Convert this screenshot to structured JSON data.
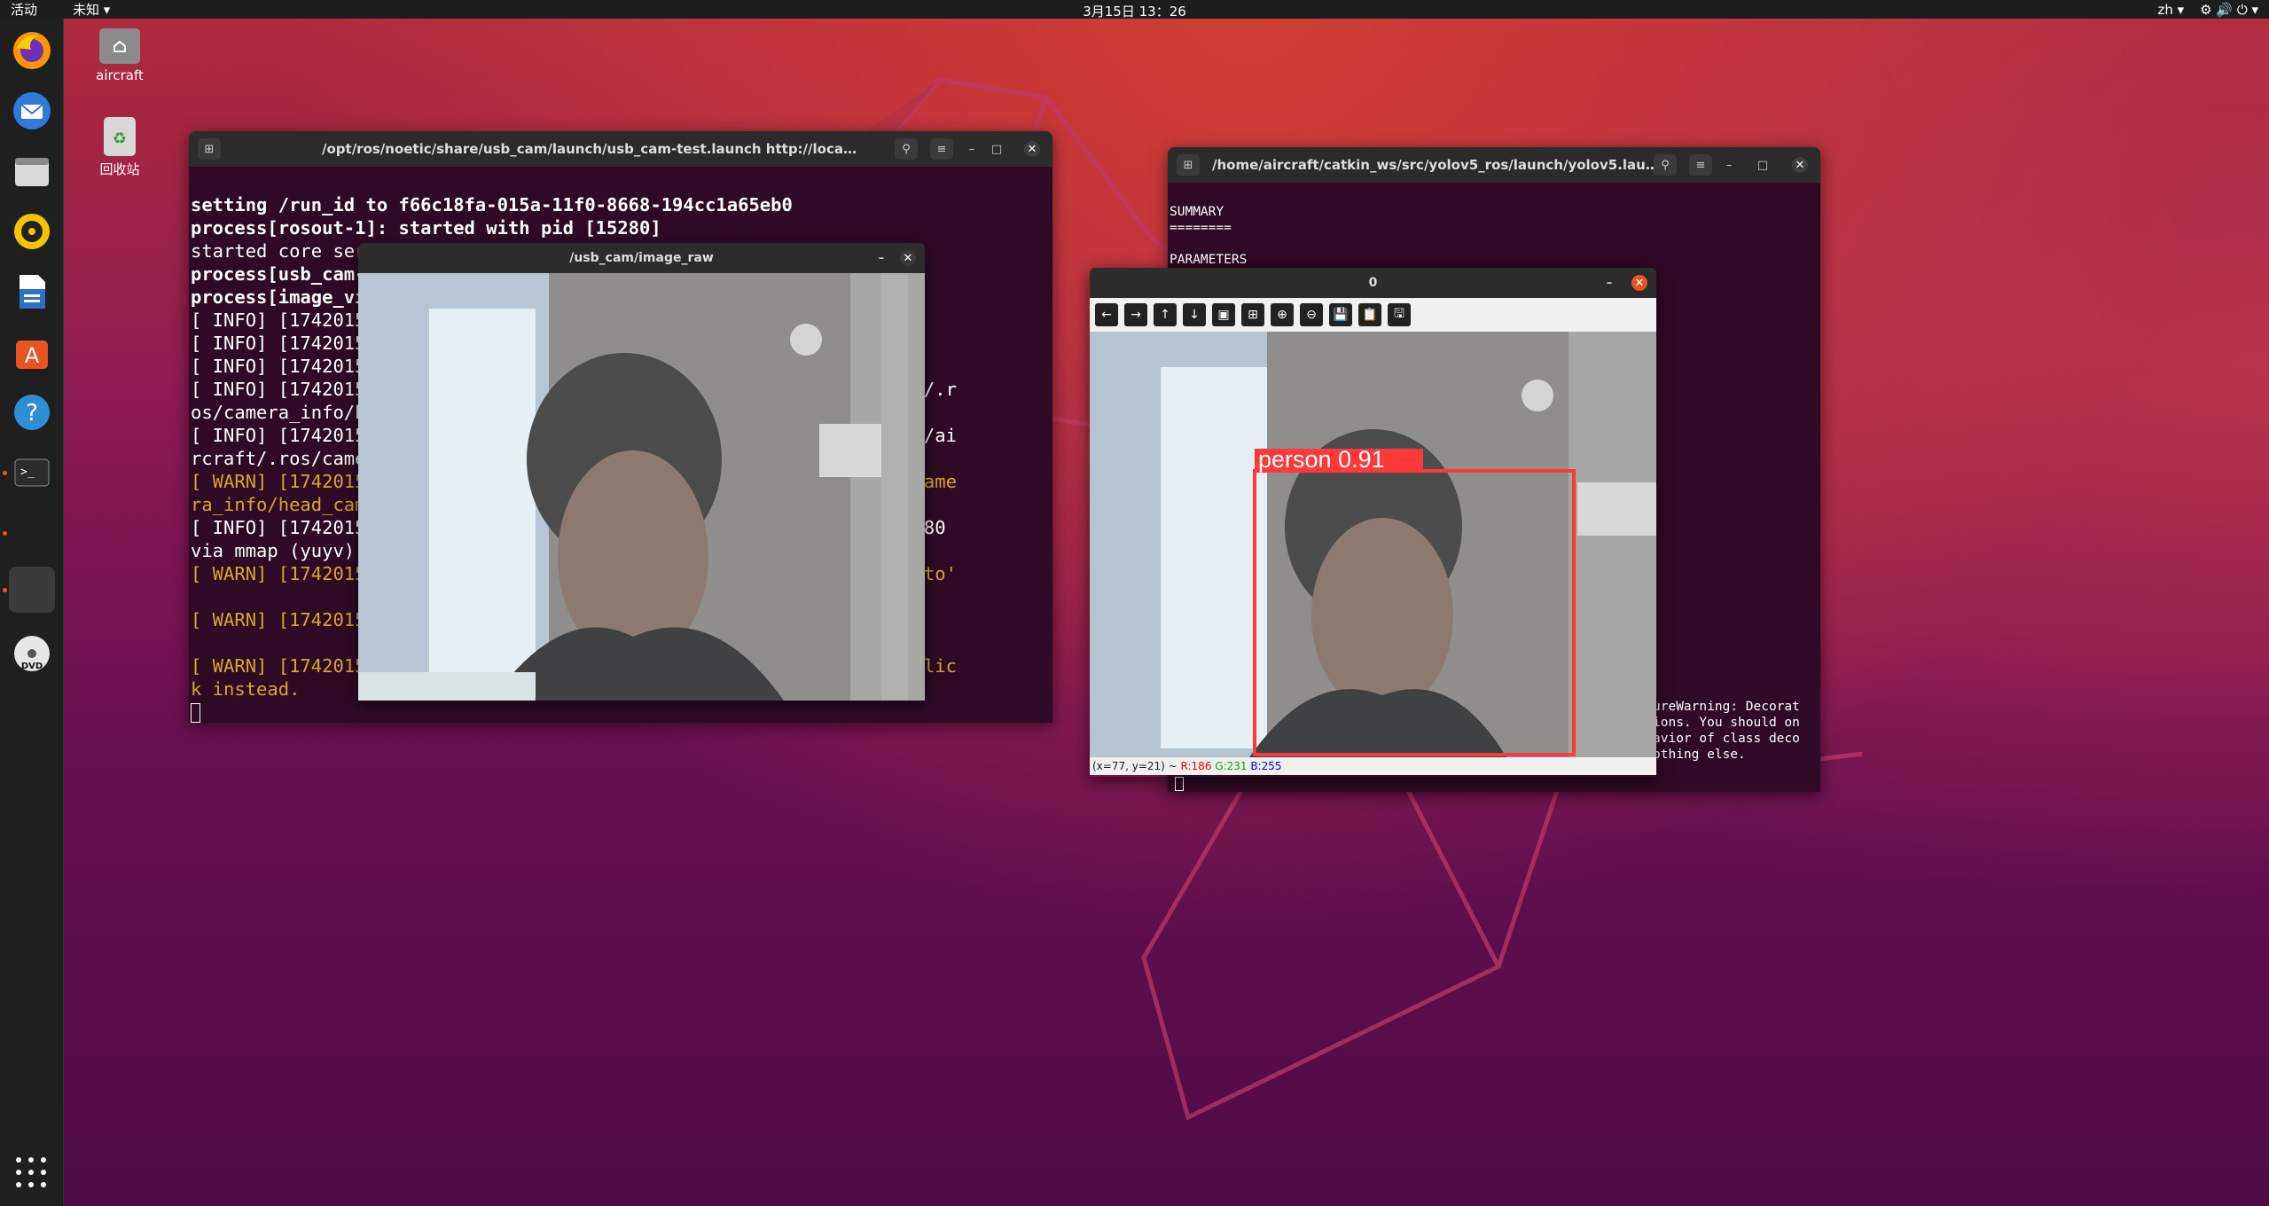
{
  "topbar": {
    "activities": "活动",
    "app_menu": "未知 ▾",
    "clock": "3月15日 13：26",
    "lang": "zh ▾",
    "tray": "⚙ 🔊 ⏻ ▾"
  },
  "desktop": {
    "home_label": "aircraft",
    "trash_label": "回收站"
  },
  "dock": {
    "items": [
      "firefox-icon",
      "thunderbird-icon",
      "files-icon",
      "rhythmbox-icon",
      "writer-icon",
      "software-icon",
      "help-icon",
      "terminal-icon",
      "active-window-icon",
      "dvd-icon"
    ]
  },
  "terminal1": {
    "title": "/opt/ros/noetic/share/usb_cam/launch/usb_cam-test.launch http://localhost:11311",
    "lines": [
      {
        "text": "",
        "cls": ""
      },
      {
        "text": "setting /run_id to f66c18fa-015a-11f0-8668-194cc1a65eb0",
        "cls": "b"
      },
      {
        "text": "process[rosout-1]: started with pid [15280]",
        "cls": "b"
      },
      {
        "text": "started core ser",
        "cls": ""
      },
      {
        "text": "process[usb_cam-",
        "cls": "b"
      },
      {
        "text": "process[image_vi",
        "cls": "b"
      },
      {
        "text": "[ INFO] [1742015                                            reads.",
        "cls": ""
      },
      {
        "text": "[ INFO] [1742015",
        "cls": ""
      },
      {
        "text": "[ INFO] [1742015",
        "cls": ""
      },
      {
        "text": "[ INFO] [1742015                                           aircraft/.r",
        "cls": ""
      },
      {
        "text": "os/camera_info/h",
        "cls": ""
      },
      {
        "text": "[ INFO] [1742015                                           e [/home/ai",
        "cls": ""
      },
      {
        "text": "rcraft/.ros/came",
        "cls": ""
      },
      {
        "text": "[ WARN] [1742015                                           t/.ros/came",
        "cls": "warn"
      },
      {
        "text": "ra_info/head_cam",
        "cls": "warn"
      },
      {
        "text": "[ INFO] [1742015                                           at 640x480",
        "cls": ""
      },
      {
        "text": "via mmap (yuyv)",
        "cls": ""
      },
      {
        "text": "[ WARN] [1742015                                           ature_auto'",
        "cls": "warn"
      },
      {
        "text": "",
        "cls": ""
      },
      {
        "text": "[ WARN] [1742015",
        "cls": "warn"
      },
      {
        "text": "",
        "cls": ""
      },
      {
        "text": "[ WARN] [1742015                                            Right-clic",
        "cls": "warn"
      },
      {
        "text": "k instead.",
        "cls": "warn"
      }
    ]
  },
  "terminal2": {
    "title": "/home/aircraft/catkin_ws/src/yolov5_ros/launch/yolov5.laun...",
    "lines": [
      "",
      "SUMMARY",
      "========",
      "",
      "PARAMETERS"
    ],
    "tail_lines": [
      "ureWarning: Decorat",
      "ions. You should on",
      "avior of class deco",
      "othing else."
    ]
  },
  "image_raw_window": {
    "title": "/usb_cam/image_raw"
  },
  "detect_window": {
    "title": "0",
    "toolbar": [
      "←",
      "→",
      "↑",
      "↓",
      "▣",
      "⊞",
      "⊕",
      "⊖",
      "💾",
      "📋",
      "🖫"
    ],
    "detection_label": "person 0.91",
    "status_coords": "(x=77, y=21) ~ ",
    "status_r": "R:186",
    "status_g": "G:231",
    "status_b": "B:255"
  },
  "colors": {
    "terminal_bg": "#300a24",
    "warn": "#d3a82c",
    "bbox": "#ff3838",
    "accent": "#e95420"
  }
}
